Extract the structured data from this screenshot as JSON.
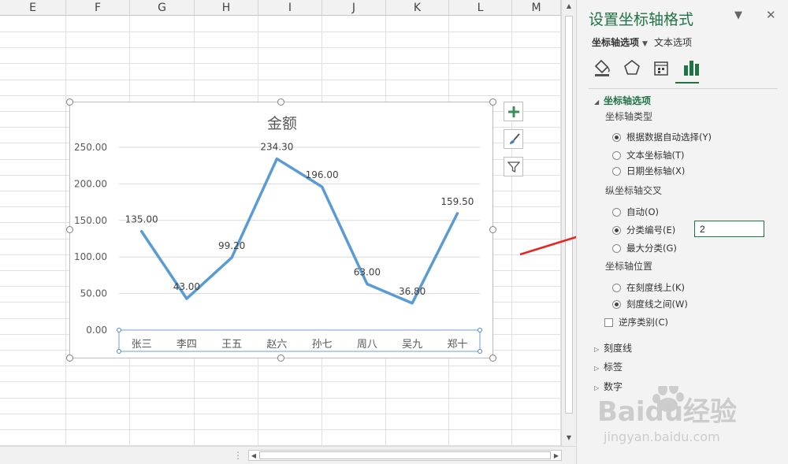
{
  "sheet": {
    "columns": [
      "E",
      "F",
      "G",
      "H",
      "I",
      "J",
      "K",
      "L",
      "M"
    ]
  },
  "chart_data": {
    "type": "line",
    "title": "金额",
    "categories": [
      "张三",
      "李四",
      "王五",
      "赵六",
      "孙七",
      "周八",
      "吴九",
      "郑十"
    ],
    "values": [
      135.0,
      43.0,
      99.2,
      234.3,
      196.0,
      63.0,
      36.8,
      159.5
    ],
    "data_labels": [
      "135.00",
      "43.00",
      "99.20",
      "234.30",
      "196.00",
      "63.00",
      "36.80",
      "159.50"
    ],
    "y_ticks": [
      "0.00",
      "50.00",
      "100.00",
      "150.00",
      "200.00",
      "250.00"
    ],
    "ylim": [
      0,
      250
    ],
    "grid": true,
    "line_color": "#5b9bd5"
  },
  "chart_buttons": {
    "add_icon": "plus-icon",
    "style_icon": "brush-icon",
    "filter_icon": "funnel-icon"
  },
  "pane": {
    "title": "设置坐标轴格式",
    "tab_axis": "坐标轴选项",
    "tab_text": "文本选项",
    "section_axis_options": "坐标轴选项",
    "axis_type_label": "坐标轴类型",
    "axis_type_options": [
      "根据数据自动选择(Y)",
      "文本坐标轴(T)",
      "日期坐标轴(X)"
    ],
    "cross_label": "纵坐标轴交叉",
    "cross_options": [
      "自动(O)",
      "分类编号(E)",
      "最大分类(G)"
    ],
    "cross_value": "2",
    "position_label": "坐标轴位置",
    "position_options": [
      "在刻度线上(K)",
      "刻度线之间(W)"
    ],
    "reverse_label": "逆序类别(C)",
    "collapsed_sections": [
      "刻度线",
      "标签",
      "数字"
    ]
  },
  "watermark": {
    "brand": "Baidu经验",
    "url": "jingyan.baidu.com"
  },
  "colors": {
    "accent": "#217346",
    "arrow": "#e8261f"
  }
}
